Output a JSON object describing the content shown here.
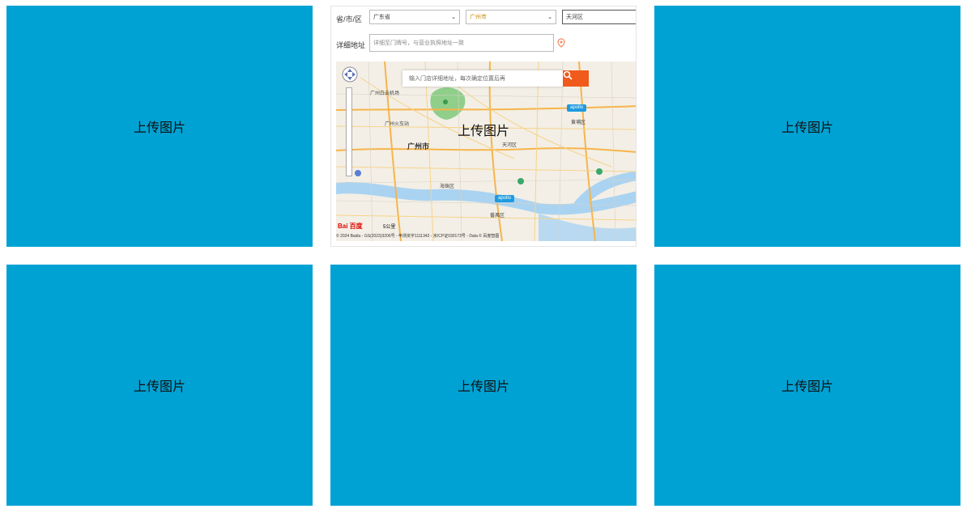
{
  "tiles": [
    {
      "label": "上传图片"
    },
    {
      "label": "上传图片"
    },
    {
      "label": "上传图片"
    },
    {
      "label": "上传图片"
    },
    {
      "label": "上传图片"
    },
    {
      "label": "上传图片"
    }
  ],
  "colors": {
    "tile_bg": "#00a2d3",
    "search_btn": "#f05a1a",
    "badge": "#1e9be0"
  },
  "form": {
    "region_label": "省/市/区",
    "province": "广东省",
    "city": "广州市",
    "district": "天河区",
    "address_label": "详细地址",
    "address_placeholder": "详细至门牌号，与营业执照地址一致"
  },
  "map": {
    "search_placeholder": "输入门店详细地址，每次确定位置后再",
    "city_label": "广州市",
    "labels": [
      "广州白云机场",
      "广州火车站",
      "海珠区",
      "天河区",
      "番禺区",
      "黄埔区"
    ],
    "badge_text": "apollo",
    "scale": "5公里",
    "logo": "Bai 百度",
    "copyright": "© 2024 Baidu - GS(2023)3206号 - 甲测资字1111342 - 京ICP证030173号 - Data © 百度智图"
  }
}
